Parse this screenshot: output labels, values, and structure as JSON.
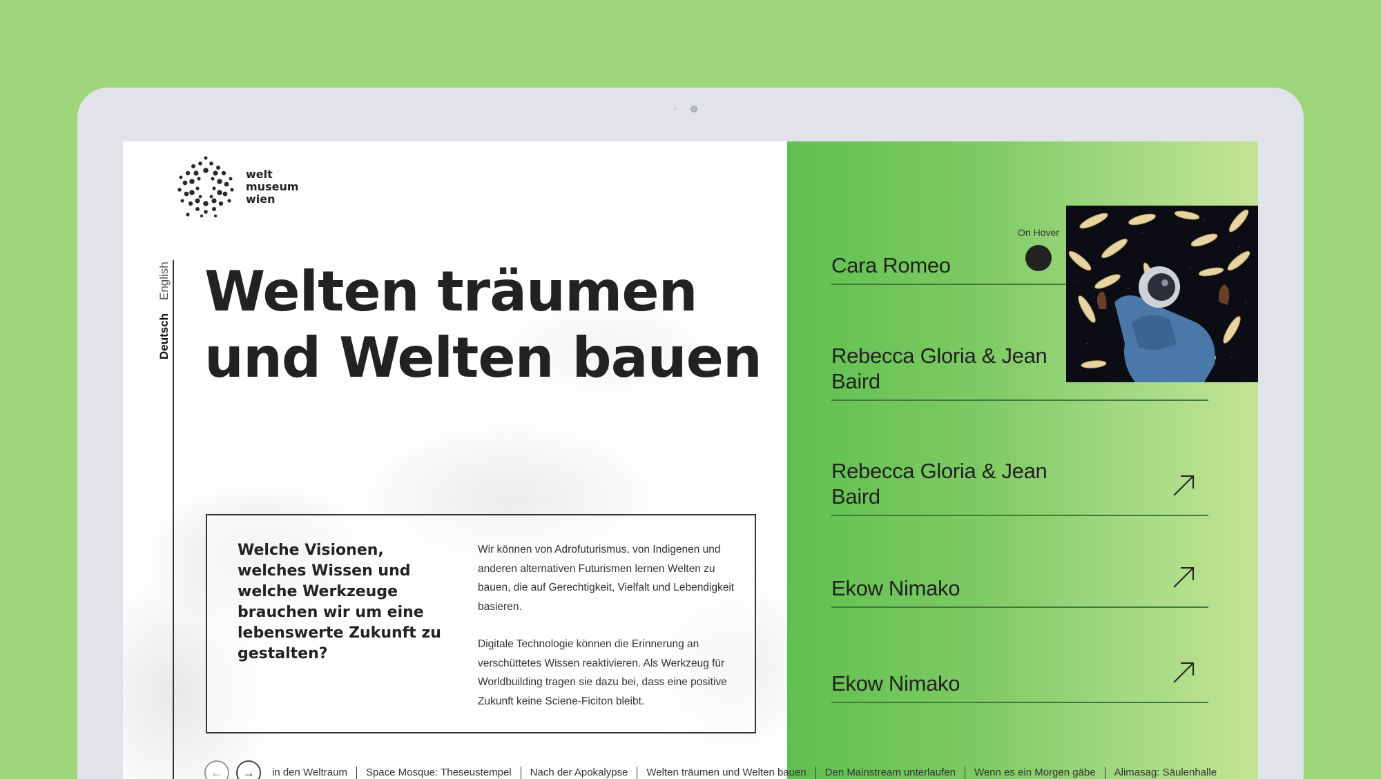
{
  "logo": {
    "line1": "welt",
    "line2": "museum",
    "line3": "wien"
  },
  "languages": {
    "english": "English",
    "deutsch": "Deutsch"
  },
  "hero": {
    "title": "Welten träumen und Welten bauen"
  },
  "info": {
    "question": "Welche Visionen, welches Wissen und welche Werkzeuge brauchen wir um eine lebenswerte Zukunft zu gestalten?",
    "paragraph1": "Wir können von Adrofuturismus, von Indigenen und anderen alternativen Futurismen lernen Welten zu bauen, die auf Gerechtigkeit, Vielfalt und Lebendigkeit basieren.",
    "paragraph2": "Digitale Technologie können die Erinnerung an verschüttetes Wissen reaktivieren. Als Werkzeug für Worldbuilding tragen sie dazu bei, dass eine positive Zukunft keine Sciene-Ficiton bleibt."
  },
  "bottom_nav": {
    "prev_icon": "arrow-left-icon",
    "next_icon": "arrow-right-icon",
    "links": [
      "in den Weltraum",
      "Space Mosque: Theseustempel",
      "Nach der Apokalypse",
      "Welten träumen und Welten bauen",
      "Den Mainstream unterlaufen",
      "Wenn es ein Morgen gäbe",
      "Alimasag: Säulenhalle"
    ]
  },
  "hover": {
    "label": "On Hover"
  },
  "artists": [
    {
      "name": "Cara Romeo"
    },
    {
      "name": "Rebecca Gloria & Jean Baird"
    },
    {
      "name": "Rebecca Gloria & Jean Baird"
    },
    {
      "name": "Ekow Nimako"
    },
    {
      "name": "Ekow Nimako"
    }
  ],
  "colors": {
    "page_background": "#9dd67b",
    "device_frame": "#e1e3e8",
    "panel_green_left": "#5fc04f",
    "panel_green_right": "#c4e495",
    "text_dark": "#222222"
  }
}
